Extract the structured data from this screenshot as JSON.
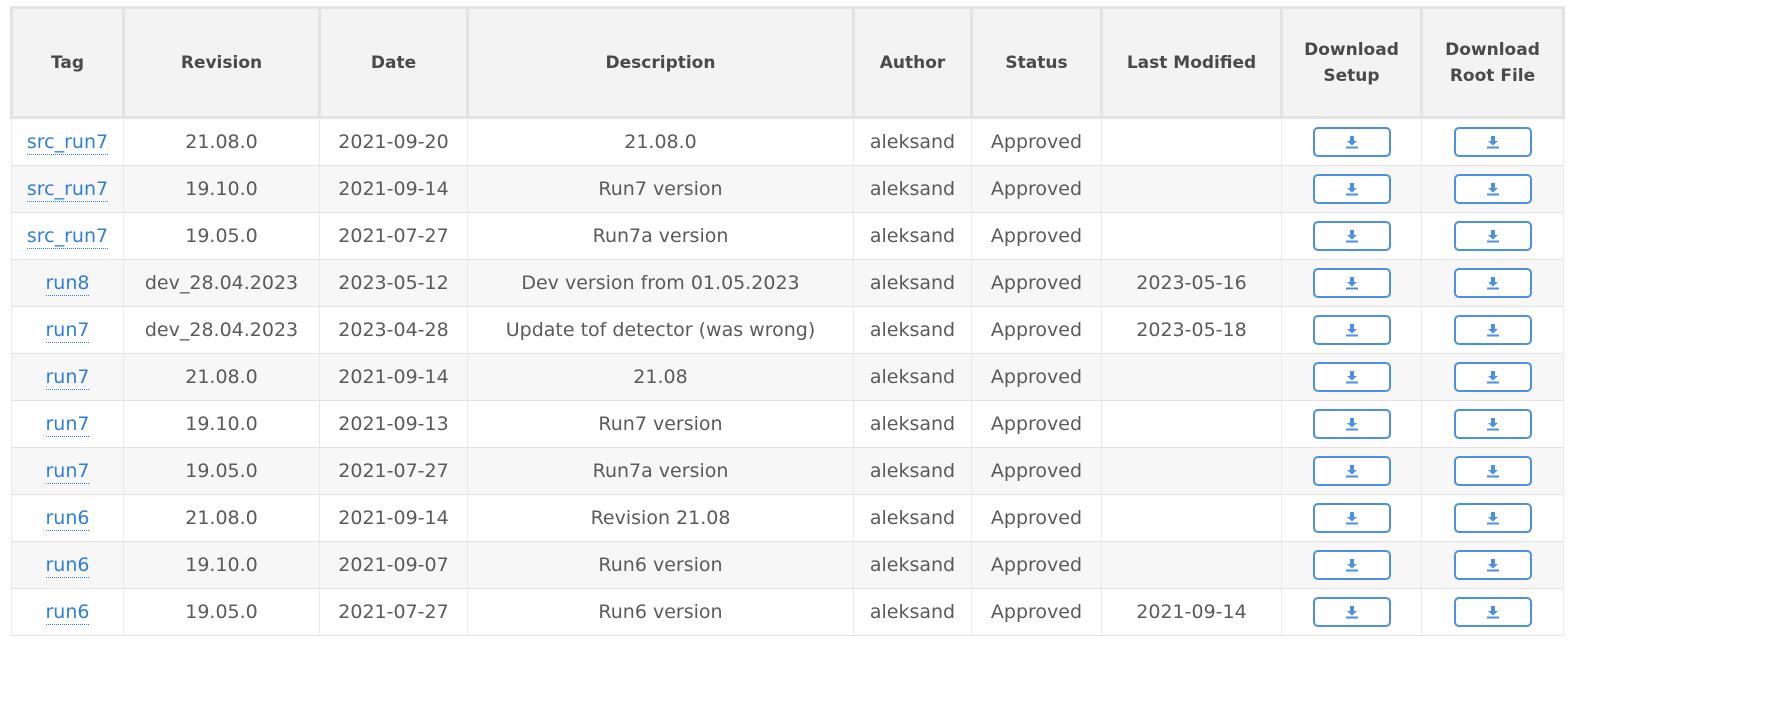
{
  "table": {
    "headers": [
      {
        "id": "tag",
        "label": "Tag"
      },
      {
        "id": "revision",
        "label": "Revision"
      },
      {
        "id": "date",
        "label": "Date"
      },
      {
        "id": "description",
        "label": "Description"
      },
      {
        "id": "author",
        "label": "Author"
      },
      {
        "id": "status",
        "label": "Status"
      },
      {
        "id": "last_modified",
        "label": "Last Modified"
      },
      {
        "id": "download_setup",
        "label": "Download Setup"
      },
      {
        "id": "download_root_file",
        "label": "Download Root File"
      }
    ],
    "rows": [
      {
        "tag": "src_run7",
        "revision": "21.08.0",
        "date": "2021-09-20",
        "description": "21.08.0",
        "author": "aleksand",
        "status": "Approved",
        "last_modified": ""
      },
      {
        "tag": "src_run7",
        "revision": "19.10.0",
        "date": "2021-09-14",
        "description": "Run7 version",
        "author": "aleksand",
        "status": "Approved",
        "last_modified": ""
      },
      {
        "tag": "src_run7",
        "revision": "19.05.0",
        "date": "2021-07-27",
        "description": "Run7a version",
        "author": "aleksand",
        "status": "Approved",
        "last_modified": ""
      },
      {
        "tag": "run8",
        "revision": "dev_28.04.2023",
        "date": "2023-05-12",
        "description": "Dev version from 01.05.2023",
        "author": "aleksand",
        "status": "Approved",
        "last_modified": "2023-05-16"
      },
      {
        "tag": "run7",
        "revision": "dev_28.04.2023",
        "date": "2023-04-28",
        "description": "Update tof detector (was wrong)",
        "author": "aleksand",
        "status": "Approved",
        "last_modified": "2023-05-18"
      },
      {
        "tag": "run7",
        "revision": "21.08.0",
        "date": "2021-09-14",
        "description": "21.08",
        "author": "aleksand",
        "status": "Approved",
        "last_modified": ""
      },
      {
        "tag": "run7",
        "revision": "19.10.0",
        "date": "2021-09-13",
        "description": "Run7 version",
        "author": "aleksand",
        "status": "Approved",
        "last_modified": ""
      },
      {
        "tag": "run7",
        "revision": "19.05.0",
        "date": "2021-07-27",
        "description": "Run7a version",
        "author": "aleksand",
        "status": "Approved",
        "last_modified": ""
      },
      {
        "tag": "run6",
        "revision": "21.08.0",
        "date": "2021-09-14",
        "description": "Revision 21.08",
        "author": "aleksand",
        "status": "Approved",
        "last_modified": ""
      },
      {
        "tag": "run6",
        "revision": "19.10.0",
        "date": "2021-09-07",
        "description": "Run6 version",
        "author": "aleksand",
        "status": "Approved",
        "last_modified": ""
      },
      {
        "tag": "run6",
        "revision": "19.05.0",
        "date": "2021-07-27",
        "description": "Run6 version",
        "author": "aleksand",
        "status": "Approved",
        "last_modified": "2021-09-14"
      }
    ]
  },
  "icons": {
    "download": "download-icon"
  },
  "colors": {
    "link": "#2f7fd6",
    "button_border": "#4d8fe0",
    "header_bg": "#f3f3f3"
  }
}
